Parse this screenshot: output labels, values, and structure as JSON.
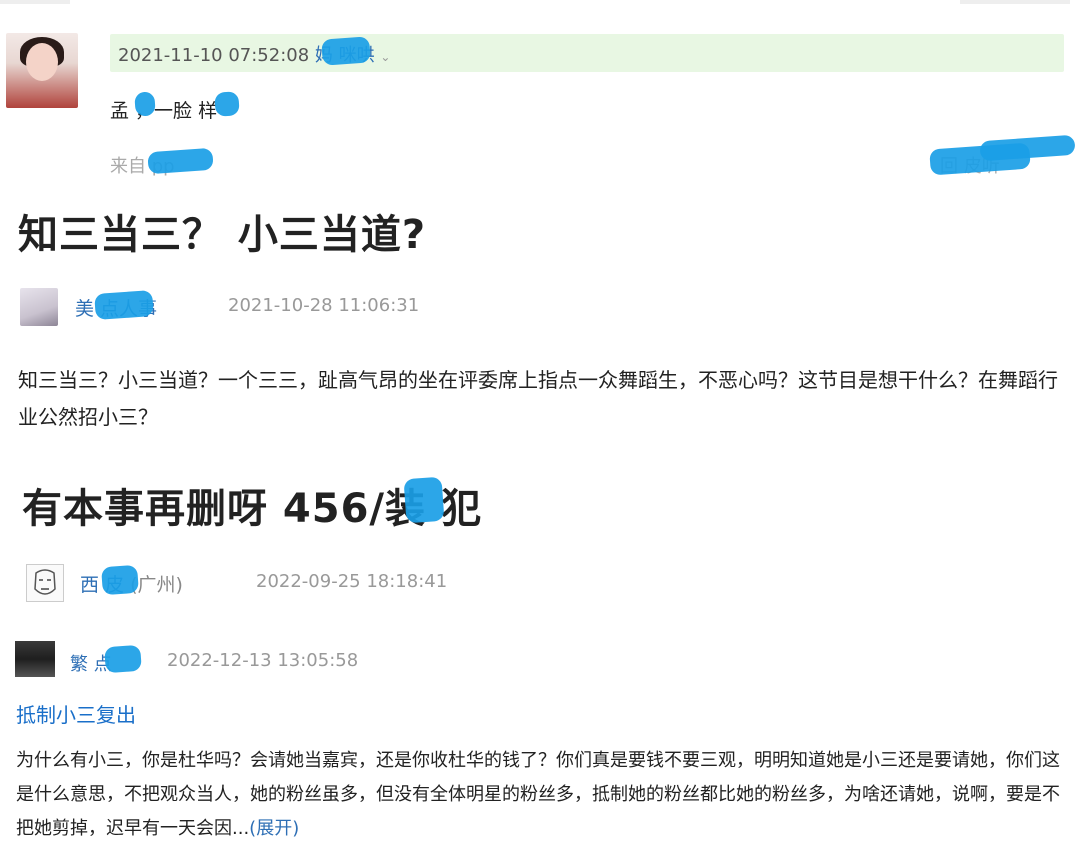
{
  "comment1": {
    "timestamp": "2021-11-10 07:52:08",
    "username": "妈 咪哄",
    "body": "孟 ，一脸 样",
    "source": "来自 pp",
    "reply_hint": "回 皮听"
  },
  "headline1": "知三当三？ 小三当道?",
  "post1": {
    "username": "美 点人事",
    "time": "2021-10-28 11:06:31",
    "text": "知三当三？小三当道？一个三三，趾高气昂的坐在评委席上指点一众舞蹈生，不恶心吗？这节目是想干什么？在舞蹈行业公然招小三？"
  },
  "headline2": "有本事再删呀 456/装 犯",
  "post2": {
    "username": "西 皮",
    "location": "(广州)",
    "time": "2022-09-25 18:18:41"
  },
  "post3": {
    "username": "繁 点",
    "time": "2022-12-13 13:05:58",
    "title": "抵制小三复出",
    "text": "为什么有小三，你是杜华吗？会请她当嘉宾，还是你收杜华的钱了？你们真是要钱不要三观，明明知道她是小三还是要请她，你们这是什么意思，不把观众当人，她的粉丝虽多，但没有全体明星的粉丝多，抵制她的粉丝都比她的粉丝多，为啥还请她，说啊，要是不把她剪掉，迟早有一天会因...",
    "expand_label": "(展开)"
  },
  "colors": {
    "link_blue": "#2e6fb5",
    "header_green_bg": "#e8f7e3",
    "redaction_blue": "#1a9ee6"
  }
}
